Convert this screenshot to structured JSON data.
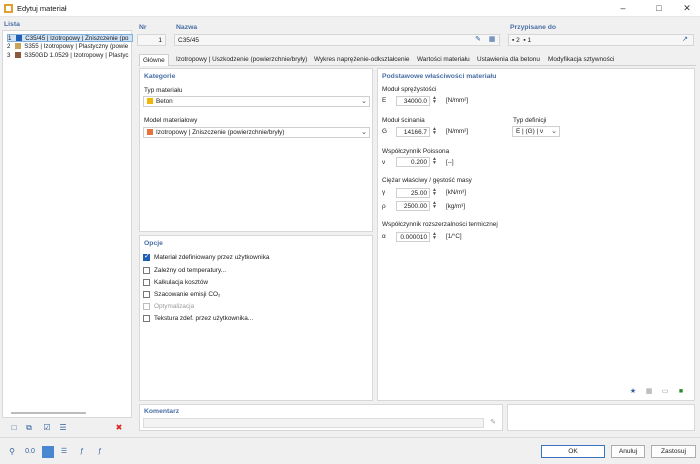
{
  "window": {
    "title": "Edytuj materiał"
  },
  "list": {
    "header": "Lista",
    "items": [
      {
        "num": "1",
        "label": "C35/45 | Izotropowy | Zniszczenie (po",
        "color": "#1f5fb4",
        "selected": true
      },
      {
        "num": "2",
        "label": "S355 | Izotropowy | Plastyczny (powie",
        "color": "#c9a45a",
        "selected": false
      },
      {
        "num": "3",
        "label": "S350GD 1.0529 | Izotropowy | Plastyc",
        "color": "#8a5a3a",
        "selected": false
      }
    ]
  },
  "nr": {
    "label": "Nr",
    "value": "1"
  },
  "nazwa": {
    "label": "Nazwa",
    "value": "C35/45"
  },
  "przypisane": {
    "label": "Przypisane do",
    "value_a": "2",
    "value_b": "1"
  },
  "tabs": [
    "Główne",
    "Izotropowy | Uszkodzenie (powierzchnie/bryły)",
    "Wykres naprężenie-odkształcenie",
    "Wartości materiału",
    "Ustawienia dla betonu",
    "Modyfikacja sztywności"
  ],
  "kategorie": {
    "header": "Kategorie",
    "typ_label": "Typ materiału",
    "typ_value": "Beton",
    "typ_color": "#f2b705",
    "model_label": "Model materiałowy",
    "model_value": "Izotropowy | Zniszczenie (powierzchnie/bryły)",
    "model_color": "#e8733a"
  },
  "opcje": {
    "header": "Opcje",
    "items": [
      {
        "label": "Materiał zdefiniowany przez użytkownika",
        "checked": true,
        "disabled": false
      },
      {
        "label": "Zależny od temperatury...",
        "checked": false,
        "disabled": false
      },
      {
        "label": "Kalkulacja kosztów",
        "checked": false,
        "disabled": false
      },
      {
        "label": "Szacowanie emisji CO₂",
        "checked": false,
        "disabled": false
      },
      {
        "label": "Optymalizacja",
        "checked": false,
        "disabled": true
      },
      {
        "label": "Tekstura zdef. przez użytkownika...",
        "checked": false,
        "disabled": false
      }
    ]
  },
  "props": {
    "header": "Podstawowe właściwości materiału",
    "e_section": "Moduł sprężystości",
    "e_sym": "E",
    "e_val": "34000.0",
    "e_unit": "[N/mm²]",
    "g_section": "Moduł ścinania",
    "g_sym": "G",
    "g_val": "14166.7",
    "g_unit": "[N/mm²]",
    "typdef_label": "Typ definicji",
    "typdef_value": "E | (G) | ν",
    "poisson_section": "Współczynnik Poissona",
    "nu_sym": "ν",
    "nu_val": "0.200",
    "nu_unit": "[--]",
    "weight_section": "Ciężar właściwy / gęstość masy",
    "gamma_sym": "γ",
    "gamma_val": "25.00",
    "gamma_unit": "[kN/m³]",
    "rho_sym": "ρ",
    "rho_val": "2500.00",
    "rho_unit": "[kg/m³]",
    "thermal_section": "Współczynnik rozszerzalności termicznej",
    "alpha_sym": "α",
    "alpha_val": "0.000010",
    "alpha_unit": "[1/°C]"
  },
  "komentarz": {
    "label": "Komentarz",
    "value": ""
  },
  "buttons": {
    "ok": "OK",
    "cancel": "Anuluj",
    "apply": "Zastosuj"
  }
}
